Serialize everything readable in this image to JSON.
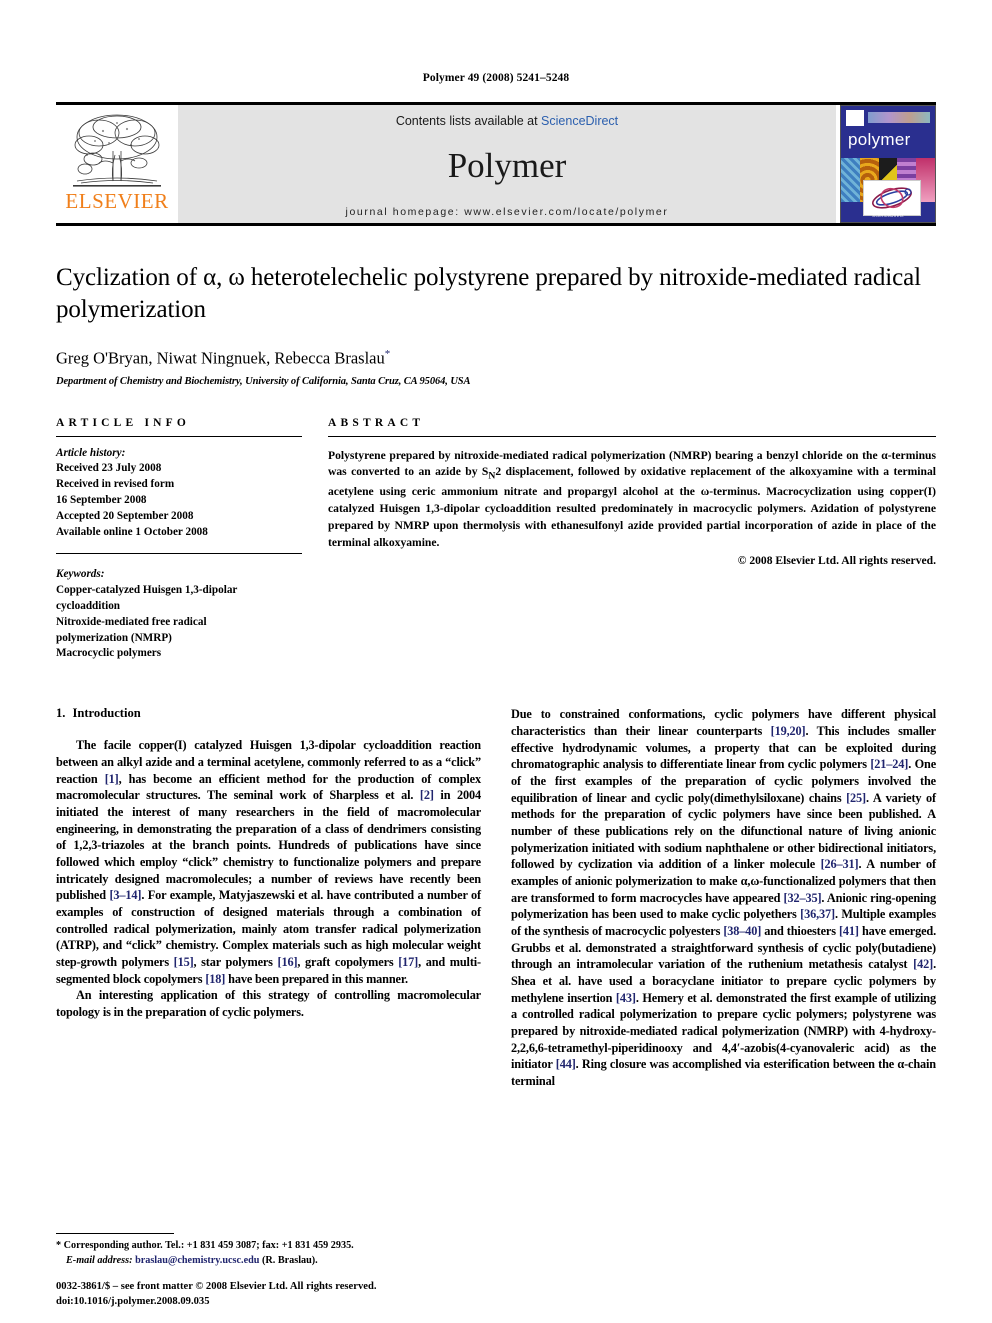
{
  "running_head": "Polymer 49 (2008) 5241–5248",
  "masthead": {
    "publisher": "ELSEVIER",
    "contents_prefix": "Contents lists available at ",
    "contents_link": "ScienceDirect",
    "journal_name": "Polymer",
    "homepage": "journal homepage: www.elsevier.com/locate/polymer",
    "cover_title": "polymer",
    "cover_footer": "ScienceDirect"
  },
  "article": {
    "title": "Cyclization of α, ω heterotelechelic polystyrene prepared by nitroxide-mediated radical polymerization",
    "authors": "Greg O'Bryan, Niwat Ningnuek, Rebecca Braslau",
    "author_marker": "*",
    "affiliation": "Department of Chemistry and Biochemistry, University of California, Santa Cruz, CA 95064, USA"
  },
  "article_info": {
    "heading": "ARTICLE INFO",
    "history_label": "Article history:",
    "history": [
      "Received 23 July 2008",
      "Received in revised form",
      "16 September 2008",
      "Accepted 20 September 2008",
      "Available online 1 October 2008"
    ],
    "keywords_label": "Keywords:",
    "keywords": [
      "Copper-catalyzed Huisgen 1,3-dipolar",
      "cycloaddition",
      "Nitroxide-mediated free radical",
      "polymerization (NMRP)",
      "Macrocyclic polymers"
    ]
  },
  "abstract": {
    "heading": "ABSTRACT",
    "part1": "Polystyrene prepared by nitroxide-mediated radical polymerization (NMRP) bearing a benzyl chloride on the α-terminus was converted to an azide by S",
    "sub_n": "N",
    "part2": "2 displacement, followed by oxidative replacement of the alkoxyamine with a terminal acetylene using ceric ammonium nitrate and propargyl alcohol at the ω-terminus. Macrocyclization using copper(I) catalyzed Huisgen 1,3-dipolar cycloaddition resulted predominately in macrocyclic polymers. Azidation of polystyrene prepared by NMRP upon thermolysis with ethanesulfonyl azide provided partial incorporation of azide in place of the terminal alkoxyamine.",
    "copyright": "© 2008 Elsevier Ltd. All rights reserved."
  },
  "introduction": {
    "number": "1.",
    "heading": "Introduction",
    "left_p1_a": "The facile copper(I) catalyzed Huisgen 1,3-dipolar cycloaddition reaction between an alkyl azide and a terminal acetylene, commonly referred to as a “click” reaction ",
    "left_p1_r1": "[1]",
    "left_p1_b": ", has become an efficient method for the production of complex macromolecular structures. The seminal work of Sharpless et al. ",
    "left_p1_r2": "[2]",
    "left_p1_c": " in 2004 initiated the interest of many researchers in the field of macromolecular engineering, in demonstrating the preparation of a class of dendrimers consisting of 1,2,3-triazoles at the branch points. Hundreds of publications have since followed which employ “click” chemistry to functionalize polymers and prepare intricately designed macromolecules; a number of reviews have recently been published ",
    "left_p1_r3": "[3–14]",
    "left_p1_d": ". For example, Matyjaszewski et al. have contributed a number of examples of construction of designed materials through a combination of controlled radical polymerization, mainly atom transfer radical polymerization (ATRP), and “click” chemistry. Complex materials such as high molecular weight step-growth polymers ",
    "left_p1_r4": "[15]",
    "left_p1_e": ", star polymers ",
    "left_p1_r5": "[16]",
    "left_p1_f": ", graft copolymers ",
    "left_p1_r6": "[17]",
    "left_p1_g": ", and multi-segmented block copolymers ",
    "left_p1_r7": "[18]",
    "left_p1_h": " have been prepared in this manner.",
    "left_p2": "An interesting application of this strategy of controlling macromolecular topology is in the preparation of cyclic polymers.",
    "right_a": "Due to constrained conformations, cyclic polymers have different physical characteristics than their linear counterparts ",
    "right_r1": "[19,20]",
    "right_b": ". This includes smaller effective hydrodynamic volumes, a property that can be exploited during chromatographic analysis to differentiate linear from cyclic polymers ",
    "right_r2": "[21–24]",
    "right_c": ". One of the first examples of the preparation of cyclic polymers involved the equilibration of linear and cyclic poly(dimethylsiloxane) chains ",
    "right_r3": "[25]",
    "right_d": ". A variety of methods for the preparation of cyclic polymers have since been published. A number of these publications rely on the difunctional nature of living anionic polymerization initiated with sodium naphthalene or other bidirectional initiators, followed by cyclization via addition of a linker molecule ",
    "right_r4": "[26–31]",
    "right_e": ". A number of examples of anionic polymerization to make α,ω-functionalized polymers that then are transformed to form macrocycles have appeared ",
    "right_r5": "[32–35]",
    "right_f": ". Anionic ring-opening polymerization has been used to make cyclic polyethers ",
    "right_r6": "[36,37]",
    "right_g": ". Multiple examples of the synthesis of macrocyclic polyesters ",
    "right_r7": "[38–40]",
    "right_h": " and thioesters ",
    "right_r8": "[41]",
    "right_i": " have emerged. Grubbs et al. demonstrated a straightforward synthesis of cyclic poly(butadiene) through an intramolecular variation of the ruthenium metathesis catalyst ",
    "right_r9": "[42]",
    "right_j": ". Shea et al. have used a boracyclane initiator to prepare cyclic polymers by methylene insertion ",
    "right_r10": "[43]",
    "right_k": ". Hemery et al. demonstrated the first example of utilizing a controlled radical polymerization to prepare cyclic polymers; polystyrene was prepared by nitroxide-mediated radical polymerization (NMRP) with 4-hydroxy-2,2,6,6-tetramethyl-piperidinooxy and 4,4′-azobis(4-cyanovaleric acid) as the initiator ",
    "right_r11": "[44]",
    "right_l": ". Ring closure was accomplished via esterification between the α-chain terminal"
  },
  "footnote": {
    "star": "*",
    "corresponding": " Corresponding author. Tel.: +1 831 459 3087; fax: +1 831 459 2935.",
    "email_label": "E-mail address:",
    "email": "braslau@chemistry.ucsc.edu",
    "email_suffix": " (R. Braslau)."
  },
  "imprint": {
    "line1": "0032-3861/$ – see front matter © 2008 Elsevier Ltd. All rights reserved.",
    "line2": "doi:10.1016/j.polymer.2008.09.035"
  },
  "colors": {
    "elsevier_orange": "#F07F1A",
    "link_blue": "#2b5fae",
    "reference_blue": "#20256e",
    "masthead_gray": "#e3e3e3",
    "cover_blue": "#2a2f8f"
  }
}
